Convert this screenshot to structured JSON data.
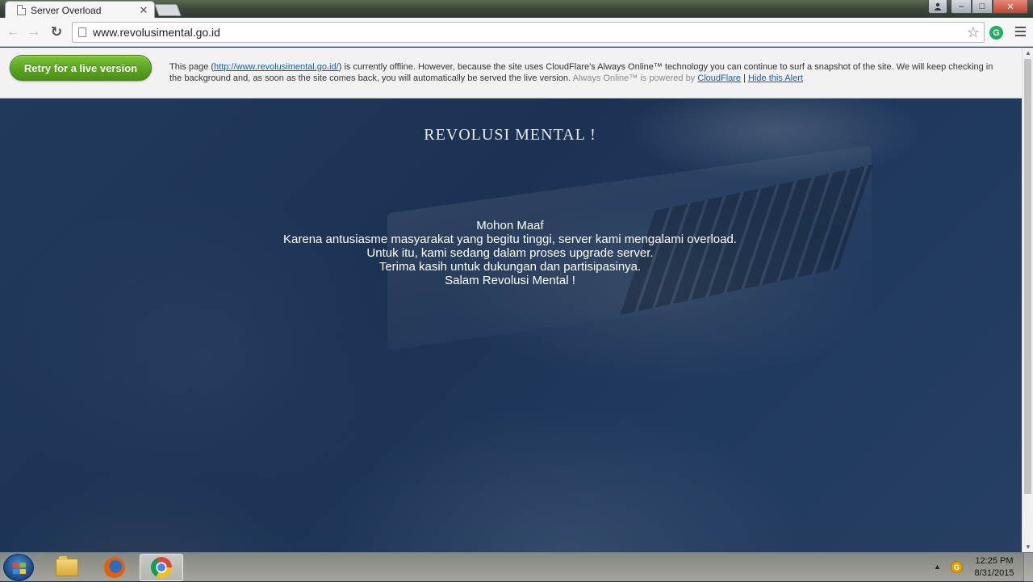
{
  "browser": {
    "tab_title": "Server Overload",
    "tab_close": "✕",
    "address": "www.revolusimental.go.id",
    "star_icon": "star-icon",
    "extension_letter": "G"
  },
  "window_controls": {
    "minimize": "–",
    "maximize": "□",
    "close": "✕"
  },
  "cloudflare_banner": {
    "retry_label": "Retry for a live version",
    "text_before_link": "This page (",
    "page_link": "http://www.revolusimental.go.id/",
    "text_after_link": ") is currently offline. However, because the site uses CloudFlare's Always Online™ technology you can continue to surf a snapshot of the site. We will keep checking in the background and, as soon as the site comes back, you will automatically be served the live version.",
    "powered_by": "Always Online™ is powered by",
    "cloudflare_link": "CloudFlare",
    "separator": "|",
    "hide_link": "Hide this Alert"
  },
  "page": {
    "site_title": "REVOLUSI MENTAL !",
    "message_lines": [
      "Mohon Maaf",
      "Karena antusiasme masyarakat yang begitu tinggi, server kami mengalami overload.",
      "Untuk itu, kami sedang dalam proses upgrade server.",
      "Terima kasih untuk dukungan dan partisipasinya.",
      "Salam Revolusi Mental !"
    ]
  },
  "taskbar": {
    "pinned": [
      "windows-explorer",
      "firefox",
      "chrome"
    ],
    "active_app": "chrome",
    "tray_arrow": "▲",
    "clock_time": "12:25 PM",
    "clock_date": "8/31/2015"
  },
  "colors": {
    "retry_button": "#5aa41f",
    "page_background": "#1c3253",
    "link": "#1a5fa8"
  }
}
